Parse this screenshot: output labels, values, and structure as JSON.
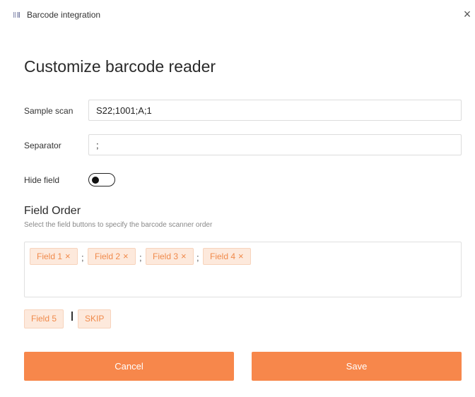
{
  "window": {
    "title": "Barcode integration",
    "close_glyph": "×",
    "title_icon": "barcode-settings-icon"
  },
  "heading": "Customize barcode reader",
  "sample_scan": {
    "label": "Sample scan",
    "value": "S22;1001;A;1"
  },
  "separator": {
    "label": "Separator",
    "value": ";"
  },
  "hide_field": {
    "label": "Hide field",
    "on": false
  },
  "field_order": {
    "title": "Field Order",
    "subtitle": "Select the field buttons to specify the barcode scanner order",
    "selected": [
      {
        "label": "Field 1",
        "remove": "×"
      },
      {
        "label": "Field 2",
        "remove": "×"
      },
      {
        "label": "Field 3",
        "remove": "×"
      },
      {
        "label": "Field 4",
        "remove": "×"
      }
    ],
    "separator_glyph": ";",
    "available": [
      "Field 5",
      "SKIP"
    ]
  },
  "buttons": {
    "cancel": "Cancel",
    "save": "Save"
  },
  "colors": {
    "accent": "#f7874b",
    "chip_bg": "#fde9dc",
    "chip_text": "#f08a4b"
  }
}
